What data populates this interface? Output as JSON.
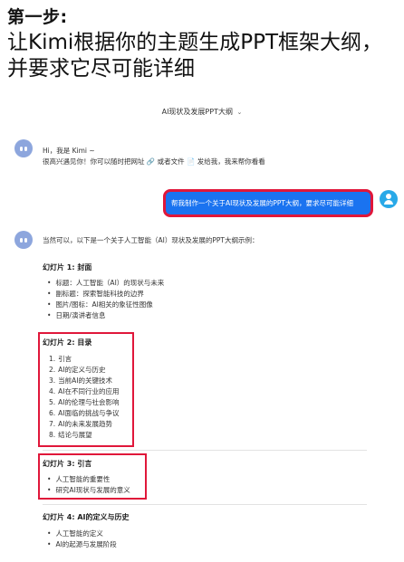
{
  "step_title": "第一步:",
  "headline": "让Kimi根据你的主题生成PPT框架大纲，并要求它尽可能详细",
  "conversation_title": "AI现状及发展PPT大纲",
  "bot_greeting": {
    "line1": "Hi，我是 Kimi ~",
    "line2": "很高兴遇见你！你可以随时把网址 🔗 或者文件 📄 发给我，我来帮你看看"
  },
  "user_message": "帮我制作一个关于AI现状及发展的PPT大纲，要求尽可能详细",
  "bot_intro": "当然可以，以下是一个关于人工智能（AI）现状及发展的PPT大纲示例：",
  "slides": [
    {
      "heading": "幻灯片 1: 封面",
      "bullets": [
        "标题：人工智能（AI）的现状与未来",
        "副标题：探索智能科技的边界",
        "图片/图标：AI相关的象征性图像",
        "日期/演讲者信息"
      ]
    },
    {
      "heading": "幻灯片 2: 目录",
      "items": [
        "引言",
        "AI的定义与历史",
        "当前AI的关键技术",
        "AI在不同行业的应用",
        "AI的伦理与社会影响",
        "AI面临的挑战与争议",
        "AI的未来发展趋势",
        "结论与展望"
      ]
    },
    {
      "heading": "幻灯片 3: 引言",
      "bullets": [
        "人工智能的重要性",
        "研究AI现状与发展的意义"
      ]
    },
    {
      "heading": "幻灯片 4: AI的定义与历史",
      "bullets": [
        "人工智能的定义",
        "AI的起源与发展阶段"
      ]
    }
  ]
}
